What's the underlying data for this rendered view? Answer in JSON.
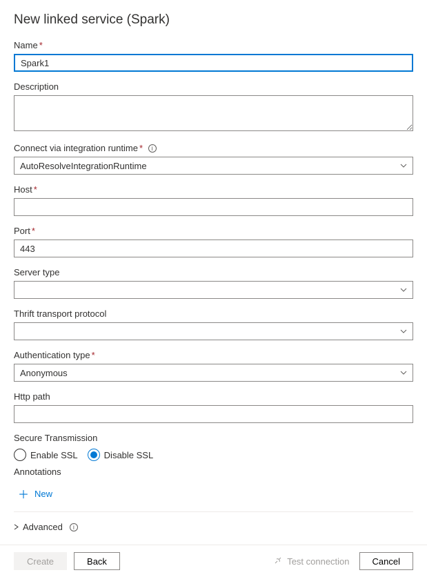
{
  "title": "New linked service (Spark)",
  "fields": {
    "name": {
      "label": "Name",
      "required": true,
      "value": "Spark1"
    },
    "description": {
      "label": "Description",
      "value": ""
    },
    "runtime": {
      "label": "Connect via integration runtime",
      "required": true,
      "value": "AutoResolveIntegrationRuntime"
    },
    "host": {
      "label": "Host",
      "required": true,
      "value": ""
    },
    "port": {
      "label": "Port",
      "required": true,
      "value": "443"
    },
    "server_type": {
      "label": "Server type",
      "value": ""
    },
    "thrift": {
      "label": "Thrift transport protocol",
      "value": ""
    },
    "auth": {
      "label": "Authentication type",
      "required": true,
      "value": "Anonymous"
    },
    "http_path": {
      "label": "Http path",
      "value": ""
    }
  },
  "secure": {
    "label": "Secure Transmission",
    "enable": "Enable SSL",
    "disable": "Disable SSL",
    "selected": "disable"
  },
  "annotations": {
    "label": "Annotations",
    "new": "New"
  },
  "advanced": {
    "label": "Advanced"
  },
  "footer": {
    "create": "Create",
    "back": "Back",
    "test": "Test connection",
    "cancel": "Cancel"
  }
}
